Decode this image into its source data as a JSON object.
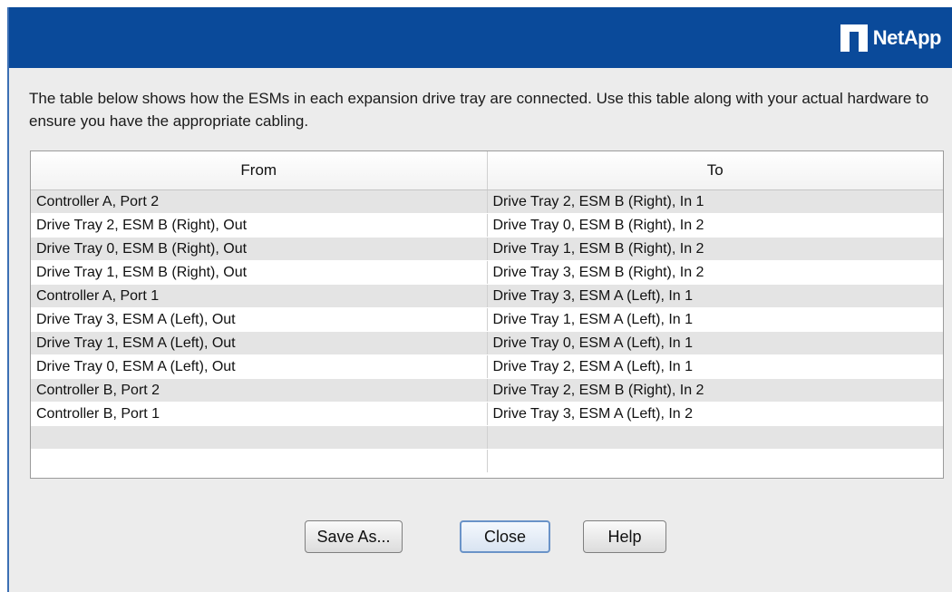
{
  "header": {
    "brand": "NetApp"
  },
  "intro_text": "The table below shows how the ESMs in each expansion drive tray are connected. Use this table along with your actual hardware to ensure you have the appropriate cabling.",
  "table": {
    "columns": [
      "From",
      "To"
    ],
    "rows": [
      [
        "Controller A, Port 2",
        "Drive Tray 2, ESM B (Right), In 1"
      ],
      [
        "Drive Tray 2, ESM B (Right), Out",
        "Drive Tray 0, ESM B (Right), In 2"
      ],
      [
        "Drive Tray 0, ESM B (Right), Out",
        "Drive Tray 1, ESM B (Right), In 2"
      ],
      [
        "Drive Tray 1, ESM B (Right), Out",
        "Drive Tray 3, ESM B (Right), In 2"
      ],
      [
        "Controller A, Port 1",
        "Drive Tray 3, ESM A (Left), In 1"
      ],
      [
        "Drive Tray 3, ESM A (Left), Out",
        "Drive Tray 1, ESM A (Left), In 1"
      ],
      [
        "Drive Tray 1, ESM A (Left), Out",
        "Drive Tray 0, ESM A (Left), In 1"
      ],
      [
        "Drive Tray 0, ESM A (Left), Out",
        "Drive Tray 2, ESM A (Left), In 1"
      ],
      [
        "Controller B, Port 2",
        "Drive Tray 2, ESM B (Right), In 2"
      ],
      [
        "Controller B, Port 1",
        "Drive Tray 3, ESM A (Left), In 2"
      ],
      [
        "",
        ""
      ],
      [
        "",
        ""
      ]
    ]
  },
  "buttons": {
    "save_as": "Save As...",
    "close": "Close",
    "help": "Help"
  },
  "colors": {
    "header_bg": "#0a4a9a",
    "dialog_bg": "#ececec",
    "row_alt": "#e4e4e4"
  },
  "icons": {
    "brand_logo": "netapp-logo-icon"
  }
}
